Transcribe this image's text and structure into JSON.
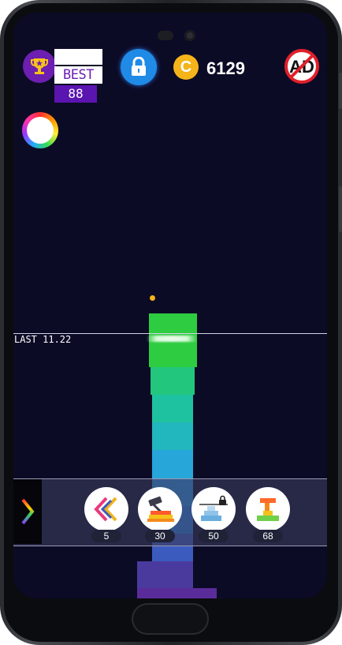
{
  "hud": {
    "best_label": "BEST",
    "best_value": "88",
    "coins": "6129",
    "coin_symbol": "C"
  },
  "game": {
    "last_label": "LAST 11.22"
  },
  "powerups": [
    {
      "icon": "double-chevron-icon",
      "count": "5"
    },
    {
      "icon": "hammer-icon",
      "count": "30"
    },
    {
      "icon": "locked-stairs-icon",
      "count": "50"
    },
    {
      "icon": "blocks-icon",
      "count": "68"
    }
  ],
  "colors": {
    "background": "#0c0b26",
    "best_purple": "#5a14b0",
    "lock_blue": "#1f8be6",
    "coin_gold": "#f4b41a"
  }
}
